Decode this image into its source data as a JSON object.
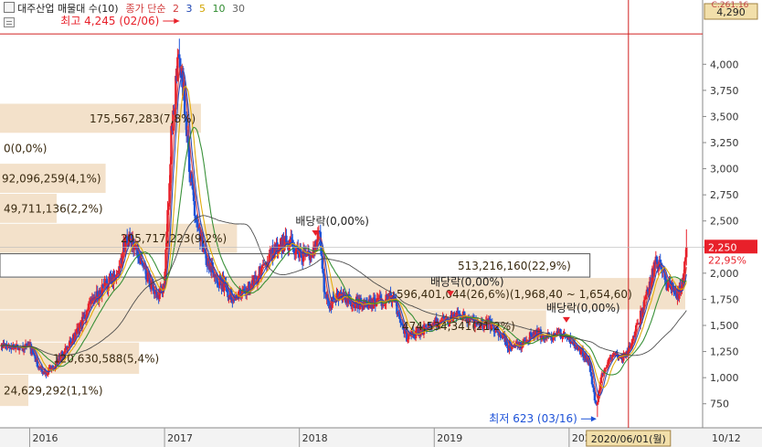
{
  "header": {
    "title": "대주산업 매물대 수(10)",
    "ma_label": "종가 단순",
    "ma_periods": [
      "2",
      "3",
      "5",
      "10",
      "30"
    ],
    "top_right_price": "4,290",
    "top_right_partial": "C:261.16"
  },
  "chart_data": {
    "type": "candlestick",
    "ylim": [
      520,
      4440
    ],
    "y_ticks": [
      "4,000",
      "3,750",
      "3,500",
      "3,250",
      "3,000",
      "2,750",
      "2,500",
      "2,250",
      "2,000",
      "1,750",
      "1,500",
      "1,250",
      "1,000",
      "750"
    ],
    "y_tick_values": [
      4000,
      3750,
      3500,
      3250,
      3000,
      2750,
      2500,
      2250,
      2000,
      1750,
      1500,
      1250,
      1000,
      750
    ],
    "x_labels": [
      "2016",
      "2017",
      "2018",
      "2019",
      "202"
    ],
    "x_label_years": [
      2016,
      2017,
      2018,
      2019,
      2020
    ],
    "price_anchors": [
      [
        2016.0,
        1300
      ],
      [
        2016.05,
        1150
      ],
      [
        2016.1,
        1040
      ],
      [
        2016.18,
        1120
      ],
      [
        2016.25,
        1230
      ],
      [
        2016.35,
        1420
      ],
      [
        2016.45,
        1700
      ],
      [
        2016.55,
        1860
      ],
      [
        2016.65,
        2000
      ],
      [
        2016.72,
        2350
      ],
      [
        2016.8,
        2200
      ],
      [
        2016.88,
        1950
      ],
      [
        2016.95,
        1750
      ],
      [
        2017.0,
        1900
      ],
      [
        2017.05,
        3300
      ],
      [
        2017.1,
        4000
      ],
      [
        2017.14,
        3800
      ],
      [
        2017.18,
        3050
      ],
      [
        2017.22,
        2650
      ],
      [
        2017.3,
        2150
      ],
      [
        2017.4,
        1950
      ],
      [
        2017.5,
        1780
      ],
      [
        2017.6,
        1820
      ],
      [
        2017.7,
        2000
      ],
      [
        2017.8,
        2200
      ],
      [
        2017.9,
        2300
      ],
      [
        2018.0,
        2200
      ],
      [
        2018.08,
        2150
      ],
      [
        2018.15,
        2400
      ],
      [
        2018.18,
        1900
      ],
      [
        2018.22,
        1700
      ],
      [
        2018.3,
        1800
      ],
      [
        2018.4,
        1730
      ],
      [
        2018.5,
        1680
      ],
      [
        2018.6,
        1740
      ],
      [
        2018.7,
        1760
      ],
      [
        2018.75,
        1500
      ],
      [
        2018.8,
        1380
      ],
      [
        2018.9,
        1450
      ],
      [
        2019.0,
        1520
      ],
      [
        2019.1,
        1560
      ],
      [
        2019.2,
        1600
      ],
      [
        2019.3,
        1520
      ],
      [
        2019.4,
        1520
      ],
      [
        2019.5,
        1400
      ],
      [
        2019.55,
        1300
      ],
      [
        2019.65,
        1320
      ],
      [
        2019.75,
        1430
      ],
      [
        2019.85,
        1400
      ],
      [
        2019.95,
        1420
      ],
      [
        2020.05,
        1320
      ],
      [
        2020.15,
        1150
      ],
      [
        2020.2,
        700
      ],
      [
        2020.24,
        1000
      ],
      [
        2020.32,
        1220
      ],
      [
        2020.4,
        1200
      ],
      [
        2020.45,
        1300
      ],
      [
        2020.52,
        1550
      ],
      [
        2020.58,
        1800
      ],
      [
        2020.64,
        2100
      ],
      [
        2020.68,
        2050
      ],
      [
        2020.72,
        1900
      ],
      [
        2020.76,
        1850
      ],
      [
        2020.8,
        1780
      ],
      [
        2020.84,
        1900
      ],
      [
        2020.87,
        2250
      ]
    ],
    "price_end_year": 2020.87,
    "moving_average_periods_days": [
      2,
      3,
      5,
      10,
      30
    ],
    "moving_average_colors": [
      "#d23c3c",
      "#2244bb",
      "#e0a800",
      "#2e8b2e",
      "#444444"
    ],
    "volume_profile": [
      {
        "label": "175,567,283(7,8%)",
        "from": 3335,
        "to": 3622,
        "width_pct": 7.8
      },
      {
        "label": "0(0,0%)",
        "from": 3048,
        "to": 3335,
        "width_pct": 0.0
      },
      {
        "label": "92,096,259(4,1%)",
        "from": 2760,
        "to": 3048,
        "width_pct": 4.1
      },
      {
        "label": "49,711,136(2,2%)",
        "from": 2473,
        "to": 2760,
        "width_pct": 2.2
      },
      {
        "label": "205,717,223(9,2%)",
        "from": 2186,
        "to": 2473,
        "width_pct": 9.2
      },
      {
        "label": "513,216,160(22,9%)",
        "from": 1954,
        "to": 2186,
        "width_pct": 22.9
      },
      {
        "label": "596,401,044(26,6%)(1,968,40 ~ 1,654,60)",
        "from": 1645,
        "to": 1954,
        "width_pct": 26.6
      },
      {
        "label": "474,534,341(21,2%)",
        "from": 1336,
        "to": 1645,
        "width_pct": 21.2
      },
      {
        "label": "120,630,588(5,4%)",
        "from": 1028,
        "to": 1336,
        "width_pct": 5.4
      },
      {
        "label": "24,629,292(1,1%)",
        "from": 720,
        "to": 1028,
        "width_pct": 1.1
      }
    ],
    "volume_profile_highlight_index": 5,
    "annotations": {
      "high": {
        "label": "최고 4,245 (02/06)",
        "price": 4245,
        "year": 2017.11
      },
      "low": {
        "label": "최저 623 (03/16)",
        "price": 623,
        "year": 2020.21
      },
      "dividends": [
        {
          "label": "배당락(0,00%)",
          "year": 2018.12,
          "price": 2410
        },
        {
          "label": "배당락(0,00%)",
          "year": 2019.12,
          "price": 1830
        },
        {
          "label": "배당락(0,00%)",
          "year": 2019.98,
          "price": 1580
        }
      ],
      "current_price": {
        "label": "2,250",
        "pct": "22,95%",
        "price": 2250
      },
      "crosshair": {
        "label": "2020/06/01(월)",
        "year": 2020.44,
        "price": 4290
      },
      "right_axis_bottom": "10/12"
    }
  }
}
